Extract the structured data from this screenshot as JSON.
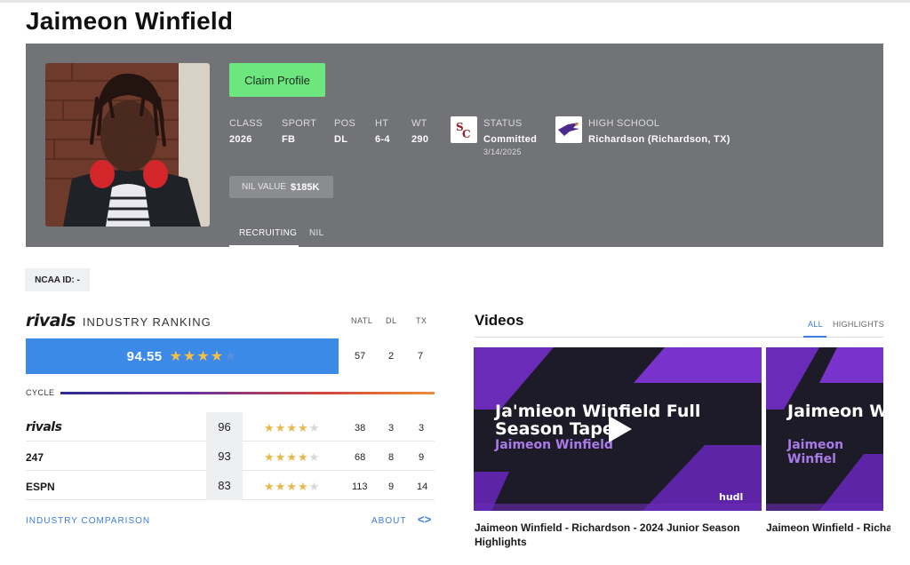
{
  "player": {
    "name": "Jaimeon Winfield"
  },
  "hero": {
    "claim_label": "Claim Profile",
    "stats": [
      {
        "label": "CLASS",
        "value": "2026"
      },
      {
        "label": "SPORT",
        "value": "FB"
      },
      {
        "label": "POS",
        "value": "DL"
      },
      {
        "label": "HT",
        "value": "6-4"
      },
      {
        "label": "WT",
        "value": "290"
      }
    ],
    "status": {
      "label": "STATUS",
      "value": "Committed",
      "date": "3/14/2025",
      "logo_icon": "usc-logo-icon"
    },
    "high_school": {
      "label": "HIGH SCHOOL",
      "value": "Richardson (Richardson, TX)",
      "logo_icon": "eagle-logo-icon"
    },
    "nil": {
      "label": "NIL VALUE",
      "value": "$185K"
    },
    "tabs": [
      {
        "label": "RECRUITING",
        "active": true
      },
      {
        "label": "NIL",
        "active": false
      }
    ]
  },
  "ncaa": {
    "label": "NCAA ID:",
    "value": "-"
  },
  "ranking": {
    "brand": "rivals",
    "title": "INDUSTRY RANKING",
    "columns": [
      "NATL",
      "DL",
      "TX"
    ],
    "score": "94.55",
    "stars": 4,
    "ranks": [
      "57",
      "2",
      "7"
    ],
    "cycle_label": "CYCLE",
    "rows": [
      {
        "source": "rivals",
        "rating": "96",
        "stars": 4,
        "natl": "38",
        "pos": "3",
        "state": "3"
      },
      {
        "source": "247",
        "rating": "93",
        "stars": 4,
        "natl": "68",
        "pos": "8",
        "state": "9"
      },
      {
        "source": "ESPN",
        "rating": "83",
        "stars": 4,
        "natl": "113",
        "pos": "9",
        "state": "14"
      }
    ],
    "comparison_link": "INDUSTRY COMPARISON",
    "about_link": "ABOUT",
    "colors": {
      "bar": "#3b8ae8",
      "star": "#f5c144",
      "link": "#3b7de0"
    }
  },
  "videos": {
    "title": "Videos",
    "tabs": [
      {
        "label": "ALL",
        "active": true
      },
      {
        "label": "HIGHLIGHTS",
        "active": false
      }
    ],
    "items": [
      {
        "thumb_title": "Ja'mieon Winfield Full Season Tape",
        "thumb_sub": "Jaimeon Winfield",
        "caption": "Jaimeon Winfield - Richardson - 2024 Junior Season Highlights",
        "brand": "hudl"
      },
      {
        "thumb_title": "Jaimeon Wi Game Clips",
        "thumb_sub": "Jaimeon Winfiel",
        "caption": "Jaimeon Winfield - Richa Highlights"
      }
    ]
  }
}
